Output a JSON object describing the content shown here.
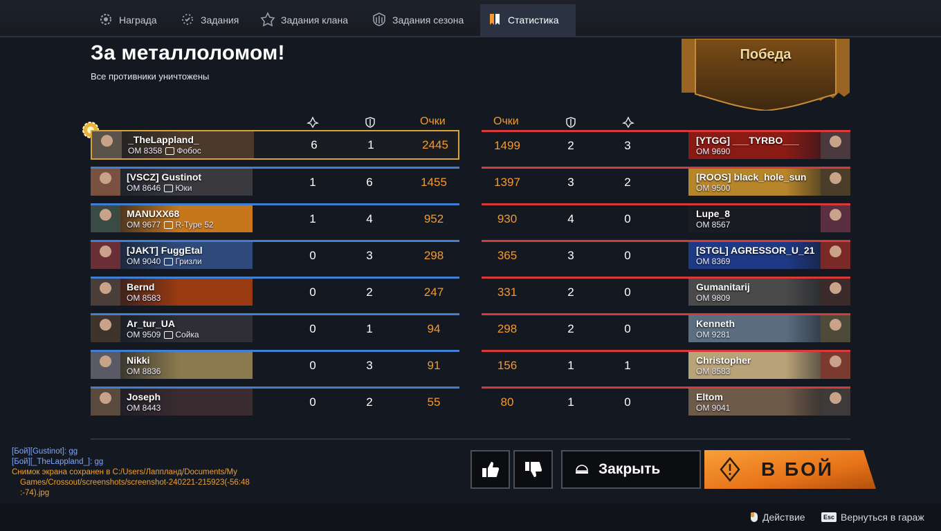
{
  "tabs": [
    {
      "label": "Награда",
      "icon": "reward-gear-icon"
    },
    {
      "label": "Задания",
      "icon": "tasks-icon"
    },
    {
      "label": "Задания клана",
      "icon": "clan-tasks-icon"
    },
    {
      "label": "Задания сезона",
      "icon": "season-tasks-icon"
    },
    {
      "label": "Статистика",
      "icon": "statistics-icon",
      "active": true
    }
  ],
  "header": {
    "title": "За металлоломом!",
    "subtitle": "Все противники уничтожены",
    "result": "Победа"
  },
  "columns": {
    "score_label": "Очки"
  },
  "team_left": [
    {
      "name": "_TheLappland_",
      "om": "ОМ 8358",
      "clan": "Фобос",
      "kills": "6",
      "assists": "1",
      "score": "2445",
      "highlight": true,
      "bg": "#4b3a2a",
      "avatar": "#5b524a"
    },
    {
      "name": "[VSCZ] Gustinot",
      "om": "ОМ 8646",
      "clan": "Юки",
      "kills": "1",
      "assists": "6",
      "score": "1455",
      "bg": "#3a3a3e",
      "avatar": "#7a5040"
    },
    {
      "name": "MANUXX68",
      "om": "ОМ 9677",
      "clan": "R-Type 52",
      "kills": "1",
      "assists": "4",
      "score": "952",
      "bg": "#c7761c",
      "avatar": "#3a4a44"
    },
    {
      "name": "[JAKT] FuggEtal",
      "om": "ОМ 9040",
      "clan": "Гризли",
      "kills": "0",
      "assists": "3",
      "score": "298",
      "bg": "#2f4a7a",
      "avatar": "#6a2e36"
    },
    {
      "name": "Bernd",
      "om": "ОМ 8583",
      "clan": "",
      "kills": "0",
      "assists": "2",
      "score": "247",
      "bg": "#9a3a12",
      "avatar": "#4a3e3a"
    },
    {
      "name": "Ar_tur_UA",
      "om": "ОМ 9509",
      "clan": "Сойка",
      "kills": "0",
      "assists": "1",
      "score": "94",
      "bg": "#2e2e34",
      "avatar": "#3e342c"
    },
    {
      "name": "Nikki",
      "om": "ОМ 8836",
      "clan": "",
      "kills": "0",
      "assists": "3",
      "score": "91",
      "bg": "#8a7a4e",
      "avatar": "#5a5a66"
    },
    {
      "name": "Joseph",
      "om": "ОМ 8443",
      "clan": "",
      "kills": "0",
      "assists": "2",
      "score": "55",
      "bg": "#3a2c30",
      "avatar": "#5a4a3e"
    }
  ],
  "team_right": [
    {
      "name": "[YTGG] ___TYRBO___",
      "om": "ОМ 9690",
      "score": "1499",
      "assists": "2",
      "kills": "3",
      "bg": "#8a1a14",
      "avatar": "#4a3a3e"
    },
    {
      "name": "[ROOS] black_hole_sun",
      "om": "ОМ 9500",
      "score": "1397",
      "assists": "3",
      "kills": "2",
      "bg": "#b8862a",
      "avatar": "#4a3e2a"
    },
    {
      "name": "Lupe_8",
      "om": "ОМ 8567",
      "score": "930",
      "assists": "4",
      "kills": "0",
      "bg": "#1a1c22",
      "avatar": "#5a3040"
    },
    {
      "name": "[STGL] AGRESSOR_U_21",
      "om": "ОМ 8369",
      "score": "365",
      "assists": "3",
      "kills": "0",
      "bg": "#1e3a86",
      "avatar": "#7a2a26"
    },
    {
      "name": "Gumanitarij",
      "om": "ОМ 9809",
      "score": "331",
      "assists": "2",
      "kills": "0",
      "bg": "#4a4a4a",
      "avatar": "#3a2a2a"
    },
    {
      "name": "Kenneth",
      "om": "ОМ 9281",
      "score": "298",
      "assists": "2",
      "kills": "0",
      "bg": "#5a6e80",
      "avatar": "#4e4a3a"
    },
    {
      "name": "Christopher",
      "om": "ОМ 8583",
      "score": "156",
      "assists": "1",
      "kills": "1",
      "bg": "#b8a278",
      "avatar": "#7a3a30"
    },
    {
      "name": "Eltom",
      "om": "ОМ 9041",
      "score": "80",
      "assists": "1",
      "kills": "0",
      "bg": "#6e5a48",
      "avatar": "#3e3a3a"
    }
  ],
  "chat": {
    "messages": [
      "[Бой][Gustinot]: gg",
      "[Бой][_TheLappland_]: gg"
    ],
    "system_line1": "Снимок экрана сохранен в C:/Users/Лаппланд/Documents/My",
    "system_line2": "Games/Crossout/screenshots/screenshot-240221-215923(-56:48",
    "system_line3": ":-74).jpg"
  },
  "buttons": {
    "like_icon": "thumbs-up-icon",
    "dislike_icon": "thumbs-down-icon",
    "close_label": "Закрыть",
    "fight_label": "В БОЙ"
  },
  "footer": {
    "action_label": "Действие",
    "esc_key": "Esc",
    "back_label": "Вернуться в гараж"
  },
  "colors": {
    "accent": "#f49a2e",
    "blue_team": "#3f7fd4",
    "red_team": "#d83a3a",
    "gold": "#d6a437"
  }
}
